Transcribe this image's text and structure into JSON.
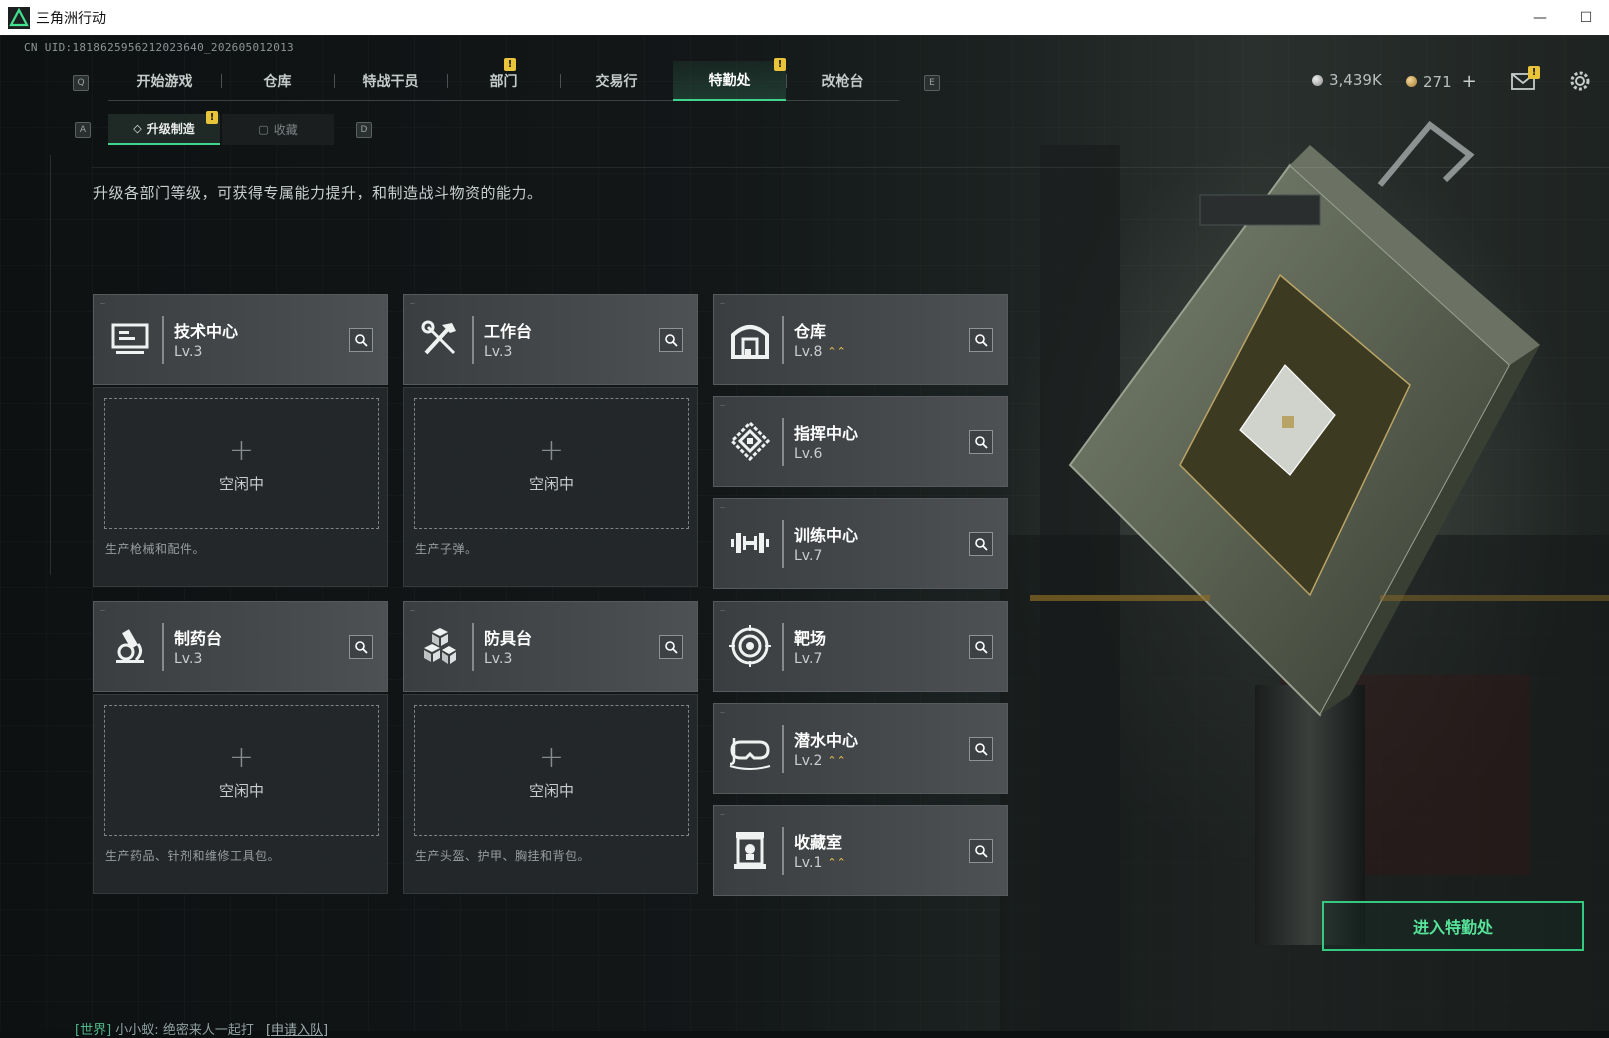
{
  "window": {
    "title": "三角洲行动",
    "minimize": "—",
    "maximize": "☐"
  },
  "uid": "CN UID:1818625956212023640_202605012013",
  "top_nav": {
    "key_left": "Q",
    "key_right": "E",
    "tabs": [
      {
        "label": "开始游戏",
        "active": false,
        "badge": ""
      },
      {
        "label": "仓库",
        "active": false,
        "badge": ""
      },
      {
        "label": "特战干员",
        "active": false,
        "badge": ""
      },
      {
        "label": "部门",
        "active": false,
        "badge": "!"
      },
      {
        "label": "交易行",
        "active": false,
        "badge": ""
      },
      {
        "label": "特勤处",
        "active": true,
        "badge": "!"
      },
      {
        "label": "改枪台",
        "active": false,
        "badge": ""
      }
    ]
  },
  "currency": {
    "silver": "3,439K",
    "gold": "271",
    "plus": "+"
  },
  "mail_badge": "!",
  "sub_nav": {
    "key_left": "A",
    "key_right": "D",
    "tabs": [
      {
        "label": "升级制造",
        "active": true,
        "badge": "!"
      },
      {
        "label": "收藏",
        "active": false
      }
    ]
  },
  "description": "升级各部门等级，可获得专属能力提升，和制造战斗物资的能力。",
  "workshops": [
    {
      "name": "技术中心",
      "level": "Lv.3",
      "icon": "monitor-icon",
      "status": "空闲中",
      "desc": "生产枪械和配件。"
    },
    {
      "name": "工作台",
      "level": "Lv.3",
      "icon": "tools-icon",
      "status": "空闲中",
      "desc": "生产子弹。"
    },
    {
      "name": "制药台",
      "level": "Lv.3",
      "icon": "microscope-icon",
      "status": "空闲中",
      "desc": "生产药品、针剂和维修工具包。"
    },
    {
      "name": "防具台",
      "level": "Lv.3",
      "icon": "armor-blocks-icon",
      "status": "空闲中",
      "desc": "生产头盔、护甲、胸挂和背包。"
    }
  ],
  "departments": [
    {
      "name": "仓库",
      "level": "Lv.8",
      "icon": "warehouse-icon",
      "upgradable": true
    },
    {
      "name": "指挥中心",
      "level": "Lv.6",
      "icon": "command-chip-icon",
      "upgradable": false
    },
    {
      "name": "训练中心",
      "level": "Lv.7",
      "icon": "dumbbell-icon",
      "upgradable": false
    },
    {
      "name": "靶场",
      "level": "Lv.7",
      "icon": "target-icon",
      "upgradable": false
    },
    {
      "name": "潜水中心",
      "level": "Lv.2",
      "icon": "diving-mask-icon",
      "upgradable": true
    },
    {
      "name": "收藏室",
      "level": "Lv.1",
      "icon": "display-case-icon",
      "upgradable": true
    }
  ],
  "plus_symbol": "+",
  "upgrade_symbol": "⌃⌃",
  "enter_button": "进入特勤处",
  "chat": {
    "channel": "[世界]",
    "user": "小小蚁:",
    "message": "绝密来人一起打",
    "action": "[申请入队]"
  },
  "colors": {
    "accent": "#3fd58e",
    "badge": "#e9c43a",
    "upgrade": "#e8c24a"
  }
}
